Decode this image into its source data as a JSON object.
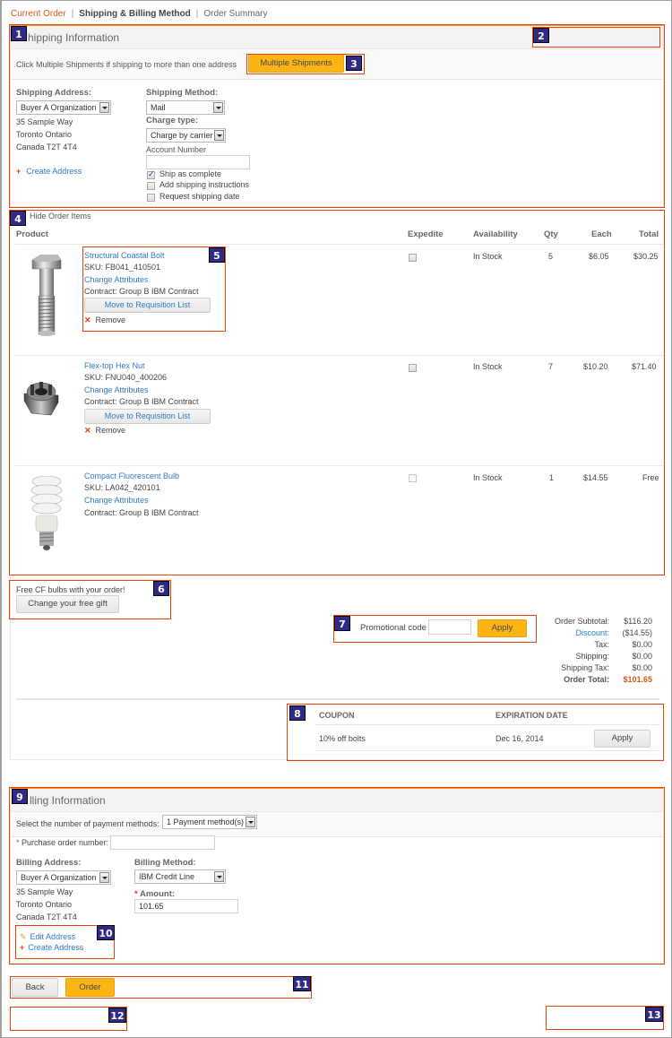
{
  "breadcrumb": {
    "current_order": "Current Order",
    "shipping_billing": "Shipping & Billing Method",
    "order_summary": "Order Summary"
  },
  "callouts": [
    "1",
    "2",
    "3",
    "4",
    "5",
    "6",
    "7",
    "8",
    "9",
    "10",
    "11",
    "12",
    "13"
  ],
  "shipping": {
    "title": "hipping Information",
    "multi_hint": "Click Multiple Shipments if shipping to more than one address",
    "multi_button": "Multiple Shipments",
    "address_label": "Shipping Address:",
    "address_select": "Buyer A Organization",
    "address_lines": [
      "35 Sample Way",
      "Toronto Ontario",
      "Canada T2T 4T4"
    ],
    "create_address": "Create Address",
    "method_label": "Shipping Method:",
    "method_select": "Mail",
    "charge_label": "Charge type:",
    "charge_select": "Charge by carrier",
    "account_label": "Account Number",
    "account_value": "",
    "options": [
      {
        "label": "Ship as complete",
        "checked": true
      },
      {
        "label": "Add shipping instructions",
        "checked": false
      },
      {
        "label": "Request shipping date",
        "checked": false
      }
    ]
  },
  "items": {
    "toggle": "Hide Order Items",
    "headers": {
      "product": "Product",
      "expedite": "Expedite",
      "availability": "Availability",
      "qty": "Qty",
      "each": "Each",
      "total": "Total"
    },
    "rows": [
      {
        "name": "Structural Coastal Bolt",
        "sku": "SKU: FB041_410501",
        "change": "Change Attributes",
        "contract": "Contract: Group B IBM Contract",
        "move": "Move to Requisition List",
        "remove": "Remove",
        "availability": "In Stock",
        "qty": "5",
        "each": "$6.05",
        "total": "$30.25",
        "image": "bolt"
      },
      {
        "name": "Flex-top Hex Nut",
        "sku": "SKU: FNU040_400206",
        "change": "Change Attributes",
        "contract": "Contract: Group B IBM Contract",
        "move": "Move to Requisition List",
        "remove": "Remove",
        "availability": "In Stock",
        "qty": "7",
        "each": "$10.20",
        "total": "$71.40",
        "image": "nut"
      },
      {
        "name": "Compact Fluorescent Bulb",
        "sku": "SKU: LA042_420101",
        "change": "Change Attributes",
        "contract": "Contract: Group B IBM Contract",
        "availability": "In Stock",
        "qty": "1",
        "each": "$14.55",
        "total": "Free",
        "image": "bulb"
      }
    ]
  },
  "gift": {
    "text": "Free CF bulbs with your order!",
    "button": "Change your free gift"
  },
  "promo": {
    "label": "Promotional code",
    "value": "",
    "button": "Apply"
  },
  "totals": [
    {
      "label": "Order Subtotal:",
      "value": "$116.20"
    },
    {
      "label": "Discount:",
      "value": "($14.55)",
      "link": true
    },
    {
      "label": "Tax:",
      "value": "$0.00"
    },
    {
      "label": "Shipping:",
      "value": "$0.00"
    },
    {
      "label": "Shipping Tax:",
      "value": "$0.00"
    },
    {
      "label": "Order Total:",
      "value": "$101.65",
      "bold": true
    }
  ],
  "coupons": {
    "headers": {
      "coupon": "COUPON",
      "expiration": "EXPIRATION DATE"
    },
    "rows": [
      {
        "name": "10% off bolts",
        "expires": "Dec 16, 2014",
        "button": "Apply"
      }
    ]
  },
  "billing": {
    "title": "lling Information",
    "payment_count_label": "Select the number of payment methods:",
    "payment_count_select": "1 Payment method(s)",
    "po_label": "Purchase order number:",
    "po_value": "",
    "address_label": "Billing Address:",
    "address_select": "Buyer A Organization",
    "address_lines": [
      "35 Sample Way",
      "Toronto Ontario",
      "Canada T2T 4T4"
    ],
    "method_label": "Billing Method:",
    "method_select": "IBM Credit Line",
    "amount_label": "Amount:",
    "amount_value": "101.65",
    "edit_address": "Edit Address",
    "create_address": "Create Address"
  },
  "actions": {
    "back": "Back",
    "order": "Order"
  },
  "colors": {
    "accent": "#fdb515",
    "callout": "#e8420d",
    "badge": "#2e2a86",
    "link": "#2f7bc6",
    "total": "#d85a1a"
  }
}
